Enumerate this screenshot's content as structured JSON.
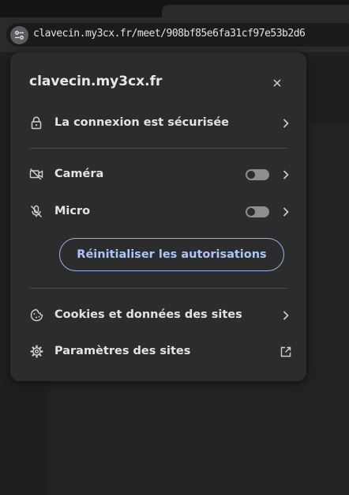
{
  "browser": {
    "address_url": "clavecin.my3cx.fr/meet/908bf85e6fa31cf97e53b2d6"
  },
  "site_info_popup": {
    "site_name": "clavecin.my3cx.fr",
    "connection_label": "La connexion est sécurisée",
    "permissions": [
      {
        "label": "Caméra",
        "icon": "camera-off-icon",
        "enabled": false
      },
      {
        "label": "Micro",
        "icon": "mic-off-icon",
        "enabled": false
      }
    ],
    "reset_button_label": "Réinitialiser les autorisations",
    "cookies_label": "Cookies et données des sites",
    "site_settings_label": "Paramètres des sites"
  },
  "colors": {
    "popup_bg": "#2c2c2c",
    "accent_blue": "#a8c7fa",
    "toggle_off": "#8e8e8e"
  }
}
